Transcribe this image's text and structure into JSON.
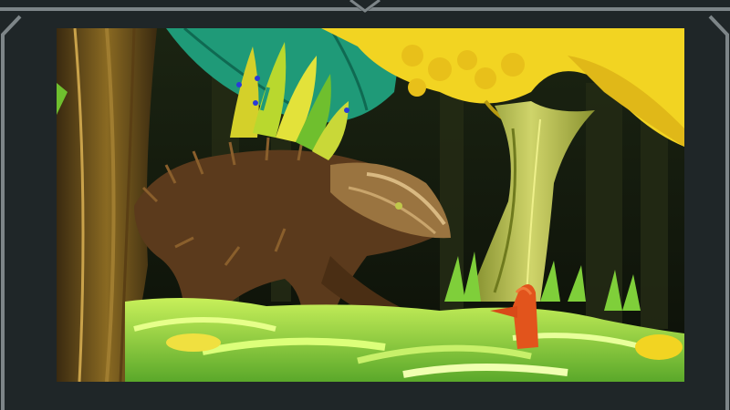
{
  "scene": {
    "palette": {
      "frame_bg": "#1f2628",
      "frame_line": "#7d8588",
      "forest_dark": "#14180f",
      "grass_light": "#b8e84a",
      "grass_mid": "#6fbf2e",
      "leaf_yellow": "#f2d422",
      "leaf_teal": "#1f9a78",
      "creature_brown": "#5b3a1c",
      "creature_highlight": "#d9b982",
      "hood_red": "#e2541c"
    },
    "icons": [
      "corner-bracket-left",
      "corner-bracket-right",
      "notch-chevron"
    ]
  }
}
